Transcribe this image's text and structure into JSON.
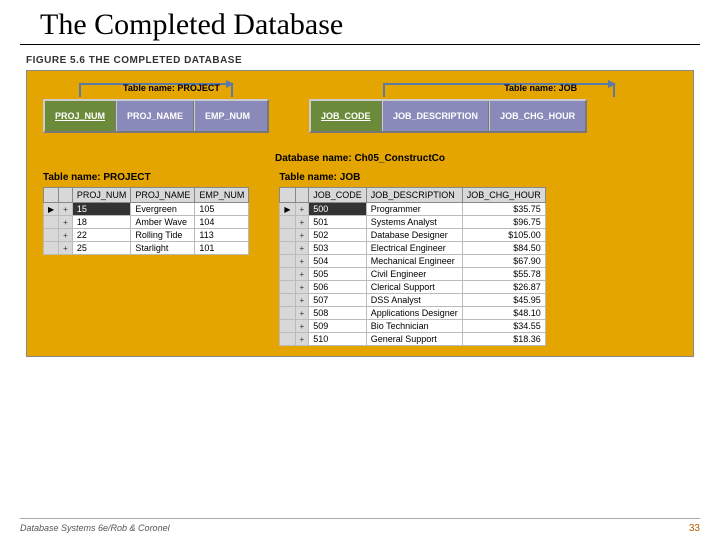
{
  "title": "The Completed Database",
  "figure_label": "FIGURE 5.6  THE COMPLETED DATABASE",
  "schema": {
    "project": {
      "caption": "Table name: PROJECT",
      "cols": [
        {
          "name": "PROJ_NUM",
          "pk": true
        },
        {
          "name": "PROJ_NAME",
          "pk": false
        },
        {
          "name": "EMP_NUM",
          "pk": false
        }
      ]
    },
    "job": {
      "caption": "Table name: JOB",
      "cols": [
        {
          "name": "JOB_CODE",
          "pk": true
        },
        {
          "name": "JOB_DESCRIPTION",
          "pk": false
        },
        {
          "name": "JOB_CHG_HOUR",
          "pk": false
        }
      ]
    }
  },
  "db_name": "Database name: Ch05_ConstructCo",
  "project_data": {
    "caption": "Table name: PROJECT",
    "headers": [
      "PROJ_NUM",
      "PROJ_NAME",
      "EMP_NUM"
    ],
    "rows": [
      {
        "marker": "▶",
        "sel": true,
        "cells": [
          "15",
          "Evergreen",
          "105"
        ]
      },
      {
        "marker": "",
        "sel": false,
        "cells": [
          "18",
          "Amber Wave",
          "104"
        ]
      },
      {
        "marker": "",
        "sel": false,
        "cells": [
          "22",
          "Rolling Tide",
          "113"
        ]
      },
      {
        "marker": "",
        "sel": false,
        "cells": [
          "25",
          "Starlight",
          "101"
        ]
      }
    ]
  },
  "job_data": {
    "caption": "Table name: JOB",
    "headers": [
      "JOB_CODE",
      "JOB_DESCRIPTION",
      "JOB_CHG_HOUR"
    ],
    "rows": [
      {
        "marker": "▶",
        "sel": true,
        "cells": [
          "500",
          "Programmer",
          "$35.75"
        ]
      },
      {
        "marker": "",
        "sel": false,
        "cells": [
          "501",
          "Systems Analyst",
          "$96.75"
        ]
      },
      {
        "marker": "",
        "sel": false,
        "cells": [
          "502",
          "Database Designer",
          "$105.00"
        ]
      },
      {
        "marker": "",
        "sel": false,
        "cells": [
          "503",
          "Electrical Engineer",
          "$84.50"
        ]
      },
      {
        "marker": "",
        "sel": false,
        "cells": [
          "504",
          "Mechanical Engineer",
          "$67.90"
        ]
      },
      {
        "marker": "",
        "sel": false,
        "cells": [
          "505",
          "Civil Engineer",
          "$55.78"
        ]
      },
      {
        "marker": "",
        "sel": false,
        "cells": [
          "506",
          "Clerical Support",
          "$26.87"
        ]
      },
      {
        "marker": "",
        "sel": false,
        "cells": [
          "507",
          "DSS Analyst",
          "$45.95"
        ]
      },
      {
        "marker": "",
        "sel": false,
        "cells": [
          "508",
          "Applications Designer",
          "$48.10"
        ]
      },
      {
        "marker": "",
        "sel": false,
        "cells": [
          "509",
          "Bio Technician",
          "$34.55"
        ]
      },
      {
        "marker": "",
        "sel": false,
        "cells": [
          "510",
          "General Support",
          "$18.36"
        ]
      }
    ]
  },
  "footer_left": "Database Systems 6e/Rob & Coronel",
  "footer_right": "33"
}
